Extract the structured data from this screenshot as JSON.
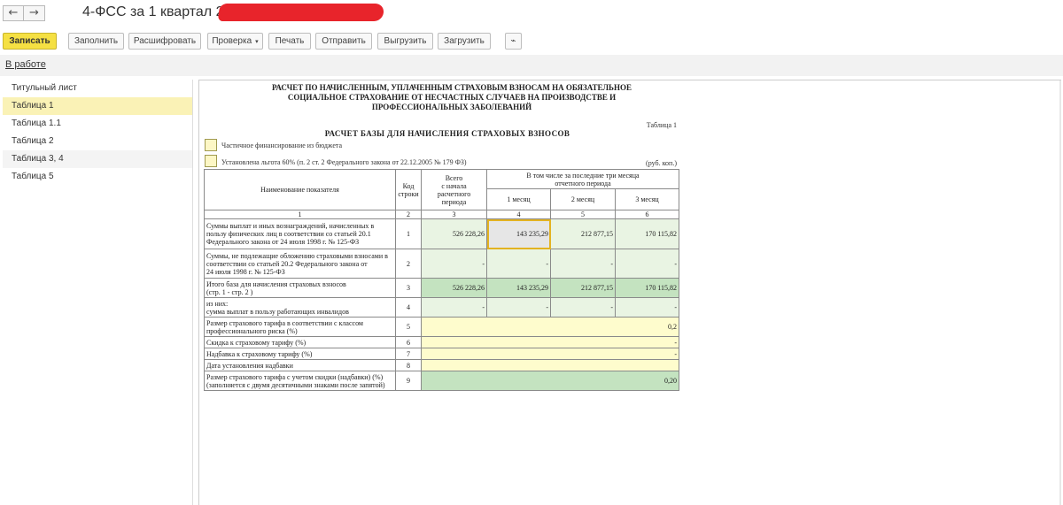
{
  "window": {
    "title": "4-ФСС за 1 квартал 2018",
    "back_icon": "←",
    "forward_icon": "→"
  },
  "toolbar": {
    "save": "Записать",
    "fill": "Заполнить",
    "decode": "Расшифровать",
    "check": "Проверка",
    "check_arrow": "▾",
    "print": "Печать",
    "send": "Отправить",
    "export": "Выгрузить",
    "import": "Загрузить",
    "attach_icon": "⌁"
  },
  "status": {
    "label": "В работе"
  },
  "sidebar": {
    "items": [
      {
        "label": "Титульный лист"
      },
      {
        "label": "Таблица 1"
      },
      {
        "label": "Таблица 1.1"
      },
      {
        "label": "Таблица 2"
      },
      {
        "label": "Таблица 3, 4"
      },
      {
        "label": "Таблица 5"
      }
    ]
  },
  "form": {
    "title_line1": "РАСЧЕТ ПО НАЧИСЛЕННЫМ, УПЛАЧЕННЫМ СТРАХОВЫМ ВЗНОСАМ НА ОБЯЗАТЕЛЬНОЕ",
    "title_line2": "СОЦИАЛЬНОЕ СТРАХОВАНИЕ ОТ НЕСЧАСТНЫХ СЛУЧАЕВ НА ПРОИЗВОДСТВЕ И",
    "title_line3": "ПРОФЕССИОНАЛЬНЫХ ЗАБОЛЕВАНИЙ",
    "table_label": "Таблица 1",
    "subtitle": "РАСЧЕТ БАЗЫ ДЛЯ НАЧИСЛЕНИЯ СТРАХОВЫХ ВЗНОСОВ",
    "checkbox1": "Частичное финансирование из бюджета",
    "checkbox2": "Установлена льгота 60% (п. 2 ст. 2 Федерального закона от 22.12.2005 № 179 ФЗ)",
    "units": "(руб. коп.)",
    "headers": {
      "name": "Наименование показателя",
      "code": "Код строки",
      "total_l1": "Всего",
      "total_l2": "с начала",
      "total_l3": "расчетного",
      "total_l4": "периода",
      "incl_l1": "В том числе за последние три месяца",
      "incl_l2": "отчетного периода",
      "m1": "1 месяц",
      "m2": "2 месяц",
      "m3": "3 месяц",
      "n1": "1",
      "n2": "2",
      "n3": "3",
      "n4": "4",
      "n5": "5",
      "n6": "6"
    },
    "rows": [
      {
        "name_l1": "Суммы выплат и иных вознаграждений, начисленных в",
        "name_l2": "пользу физических лиц в соответствии со статьей 20.1",
        "name_l3": "Федерального закона от 24 июля 1998 г. № 125-ФЗ",
        "code": "1",
        "total": "526 228,26",
        "m1": "143 235,29",
        "m2": "212 877,15",
        "m3": "170 115,82"
      },
      {
        "name_l1": "Суммы, не подлежащие обложению страховыми взносами в",
        "name_l2": "соответствии со статьей 20.2 Федерального закона от",
        "name_l3": "24 июля 1998 г. № 125-ФЗ",
        "code": "2",
        "total": "-",
        "m1": "-",
        "m2": "-",
        "m3": "-"
      },
      {
        "name_l1": "Итого база для начисления страховых взносов",
        "name_l2": "(стр. 1 - стр. 2 )",
        "code": "3",
        "total": "526 228,26",
        "m1": "143 235,29",
        "m2": "212 877,15",
        "m3": "170 115,82"
      },
      {
        "name_l1": "из них:",
        "name_l2": "сумма выплат в пользу работающих инвалидов",
        "code": "4",
        "total": "-",
        "m1": "-",
        "m2": "-",
        "m3": "-"
      },
      {
        "name_l1": "Размер страхового тарифа в соответствии с классом",
        "name_l2": "профессионального риска (%)",
        "code": "5",
        "value": "0,2"
      },
      {
        "name_l1": "Скидка к страховому тарифу (%)",
        "code": "6",
        "value": "-"
      },
      {
        "name_l1": "Надбавка к страховому тарифу (%)",
        "code": "7",
        "value": "-"
      },
      {
        "name_l1": "Дата установления надбавки",
        "code": "8",
        "value": ""
      },
      {
        "name_l1": "Размер страхового тарифа с учетом скидки (надбавки) (%)",
        "name_l2": "(заполняется с двумя десятичными знаками после запятой)",
        "code": "9",
        "value": "0,20"
      }
    ]
  }
}
